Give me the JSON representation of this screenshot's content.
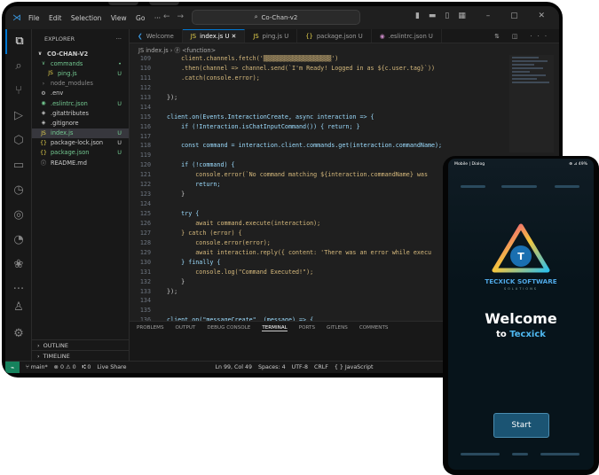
{
  "app": {
    "menu": [
      "File",
      "Edit",
      "Selection",
      "View",
      "Go",
      "···"
    ],
    "command_center": "Co-Chan-v2"
  },
  "explorer": {
    "header": "EXPLORER",
    "root": "CO-CHAN-V2",
    "tree": [
      {
        "label": "commands",
        "icon": "∨",
        "color": "#73c991",
        "status": "•",
        "depth": 1
      },
      {
        "label": "ping.js",
        "icon": "JS",
        "color": "#73c991",
        "status": "U",
        "depth": 2
      },
      {
        "label": "node_modules",
        "icon": "›",
        "color": "#8b8b8b",
        "status": "",
        "depth": 1
      },
      {
        "label": ".env",
        "icon": "⚙",
        "color": "#cccccc",
        "status": "",
        "depth": 1
      },
      {
        "label": ".eslintrc.json",
        "icon": "◉",
        "color": "#73c991",
        "status": "U",
        "depth": 1
      },
      {
        "label": ".gitattributes",
        "icon": "◈",
        "color": "#cccccc",
        "status": "",
        "depth": 1
      },
      {
        "label": ".gitignore",
        "icon": "◈",
        "color": "#cccccc",
        "status": "",
        "depth": 1
      },
      {
        "label": "index.js",
        "icon": "JS",
        "color": "#73c991",
        "status": "U",
        "depth": 1
      },
      {
        "label": "package-lock.json",
        "icon": "{}",
        "color": "#cccccc",
        "status": "U",
        "depth": 1
      },
      {
        "label": "package.json",
        "icon": "{}",
        "color": "#73c991",
        "status": "U",
        "depth": 1
      },
      {
        "label": "README.md",
        "icon": "ⓘ",
        "color": "#cccccc",
        "status": "",
        "depth": 1
      }
    ],
    "outline": "OUTLINE",
    "timeline": "TIMELINE"
  },
  "tabs": [
    {
      "label": "Welcome",
      "icon": "❮",
      "active": false
    },
    {
      "label": "index.js U ✕",
      "icon": "JS",
      "active": true
    },
    {
      "label": "ping.js U",
      "icon": "JS",
      "active": false
    },
    {
      "label": "package.json U",
      "icon": "{}",
      "active": false
    },
    {
      "label": ".eslintrc.json U",
      "icon": "◉",
      "active": false
    }
  ],
  "breadcrumb": "JS index.js › ⓟ <function>",
  "code": [
    {
      "n": "109",
      "t": "      client.channels.fetch('▒▒▒▒▒▒▒▒▒▒▒▒▒▒▒▒▒▒▒')"
    },
    {
      "n": "110",
      "t": "      .then(channel => channel.send(`I'm Ready! Logged in as ${c.user.tag}`))"
    },
    {
      "n": "111",
      "t": "      .catch(console.error);"
    },
    {
      "n": "112",
      "t": ""
    },
    {
      "n": "113",
      "t": "  });"
    },
    {
      "n": "114",
      "t": ""
    },
    {
      "n": "115",
      "t": "  client.on(Events.InteractionCreate, async interaction => {"
    },
    {
      "n": "116",
      "t": "      if (!Interaction.isChatInputCommand()) { return; }"
    },
    {
      "n": "117",
      "t": ""
    },
    {
      "n": "118",
      "t": "      const command = interaction.client.commands.get(interaction.commandName);"
    },
    {
      "n": "119",
      "t": ""
    },
    {
      "n": "120",
      "t": "      if (!command) {"
    },
    {
      "n": "121",
      "t": "          console.error(`No command matching ${interaction.commandName} was"
    },
    {
      "n": "122",
      "t": "          return;"
    },
    {
      "n": "123",
      "t": "      }"
    },
    {
      "n": "124",
      "t": ""
    },
    {
      "n": "125",
      "t": "      try {"
    },
    {
      "n": "126",
      "t": "          await command.execute(interaction);"
    },
    {
      "n": "127",
      "t": "      } catch (error) {"
    },
    {
      "n": "128",
      "t": "          console.error(error);"
    },
    {
      "n": "129",
      "t": "          await interaction.reply({ content: 'There was an error while execu"
    },
    {
      "n": "130",
      "t": "      } finally {"
    },
    {
      "n": "131",
      "t": "          console.log(\"Command Executed!\");"
    },
    {
      "n": "132",
      "t": "      }"
    },
    {
      "n": "133",
      "t": "  });"
    },
    {
      "n": "134",
      "t": ""
    },
    {
      "n": "135",
      "t": ""
    },
    {
      "n": "136",
      "t": "  client.on(\"messageCreate\", (message) => {"
    }
  ],
  "panel_tabs": [
    "PROBLEMS",
    "OUTPUT",
    "DEBUG CONSOLE",
    "TERMINAL",
    "PORTS",
    "GITLENS",
    "COMMENTS"
  ],
  "status": {
    "branch": "main*",
    "errors": "⊗ 0 ⚠ 0",
    "ports": "⑆ 0",
    "live_share": "Live Share",
    "position": "Ln 99, Col 49",
    "spaces": "Spaces: 4",
    "encoding": "UTF-8",
    "eol": "CRLF",
    "language": "{ } JavaScript"
  },
  "phone": {
    "status_left": "Mobile | Dialog",
    "status_right": "⊕ ⊿ 49%",
    "brand": "TECXICK SOFTWARE",
    "brand_sub": "SOLUTIONS",
    "title": "Welcome",
    "subtitle_prefix": "to ",
    "subtitle_name": "Tecxick",
    "start_label": "Start"
  },
  "colors": {
    "accent": "#0078d4",
    "statusbar_remote": "#16825d",
    "phone_brand": "#4fa8e6"
  }
}
